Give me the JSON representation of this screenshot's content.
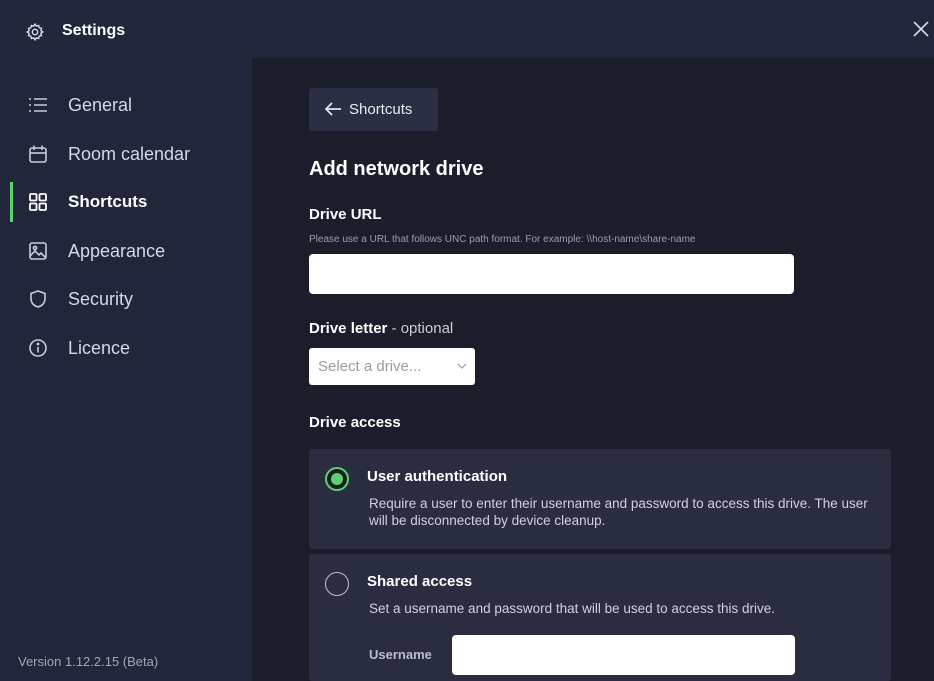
{
  "window": {
    "title": "Settings",
    "close_icon": "close-icon",
    "gear_icon": "gear-icon"
  },
  "sidebar": {
    "items": [
      {
        "label": "General",
        "icon": "list-icon"
      },
      {
        "label": "Room calendar",
        "icon": "calendar-icon"
      },
      {
        "label": "Shortcuts",
        "icon": "grid-icon",
        "active": true
      },
      {
        "label": "Appearance",
        "icon": "image-icon"
      },
      {
        "label": "Security",
        "icon": "shield-icon"
      },
      {
        "label": "Licence",
        "icon": "info-icon"
      }
    ],
    "version": "Version 1.12.2.15 (Beta)",
    "accent": "#5fd16b"
  },
  "main": {
    "back_label": "Shortcuts",
    "heading": "Add network drive",
    "drive_url": {
      "label": "Drive URL",
      "hint": "Please use a URL that follows UNC path format. For example: \\\\host-name\\share-name",
      "value": ""
    },
    "drive_letter": {
      "label": "Drive letter",
      "optional": " - optional",
      "selected": "Select a drive..."
    },
    "drive_access": {
      "label": "Drive access",
      "options": [
        {
          "title": "User authentication",
          "desc": "Require a user to enter their username and password to access this drive. The user will be disconnected by device cleanup.",
          "selected": true
        },
        {
          "title": "Shared access",
          "desc": "Set a username and password that will be used to access this drive.",
          "selected": false,
          "username_label": "Username",
          "username_value": ""
        }
      ]
    }
  }
}
